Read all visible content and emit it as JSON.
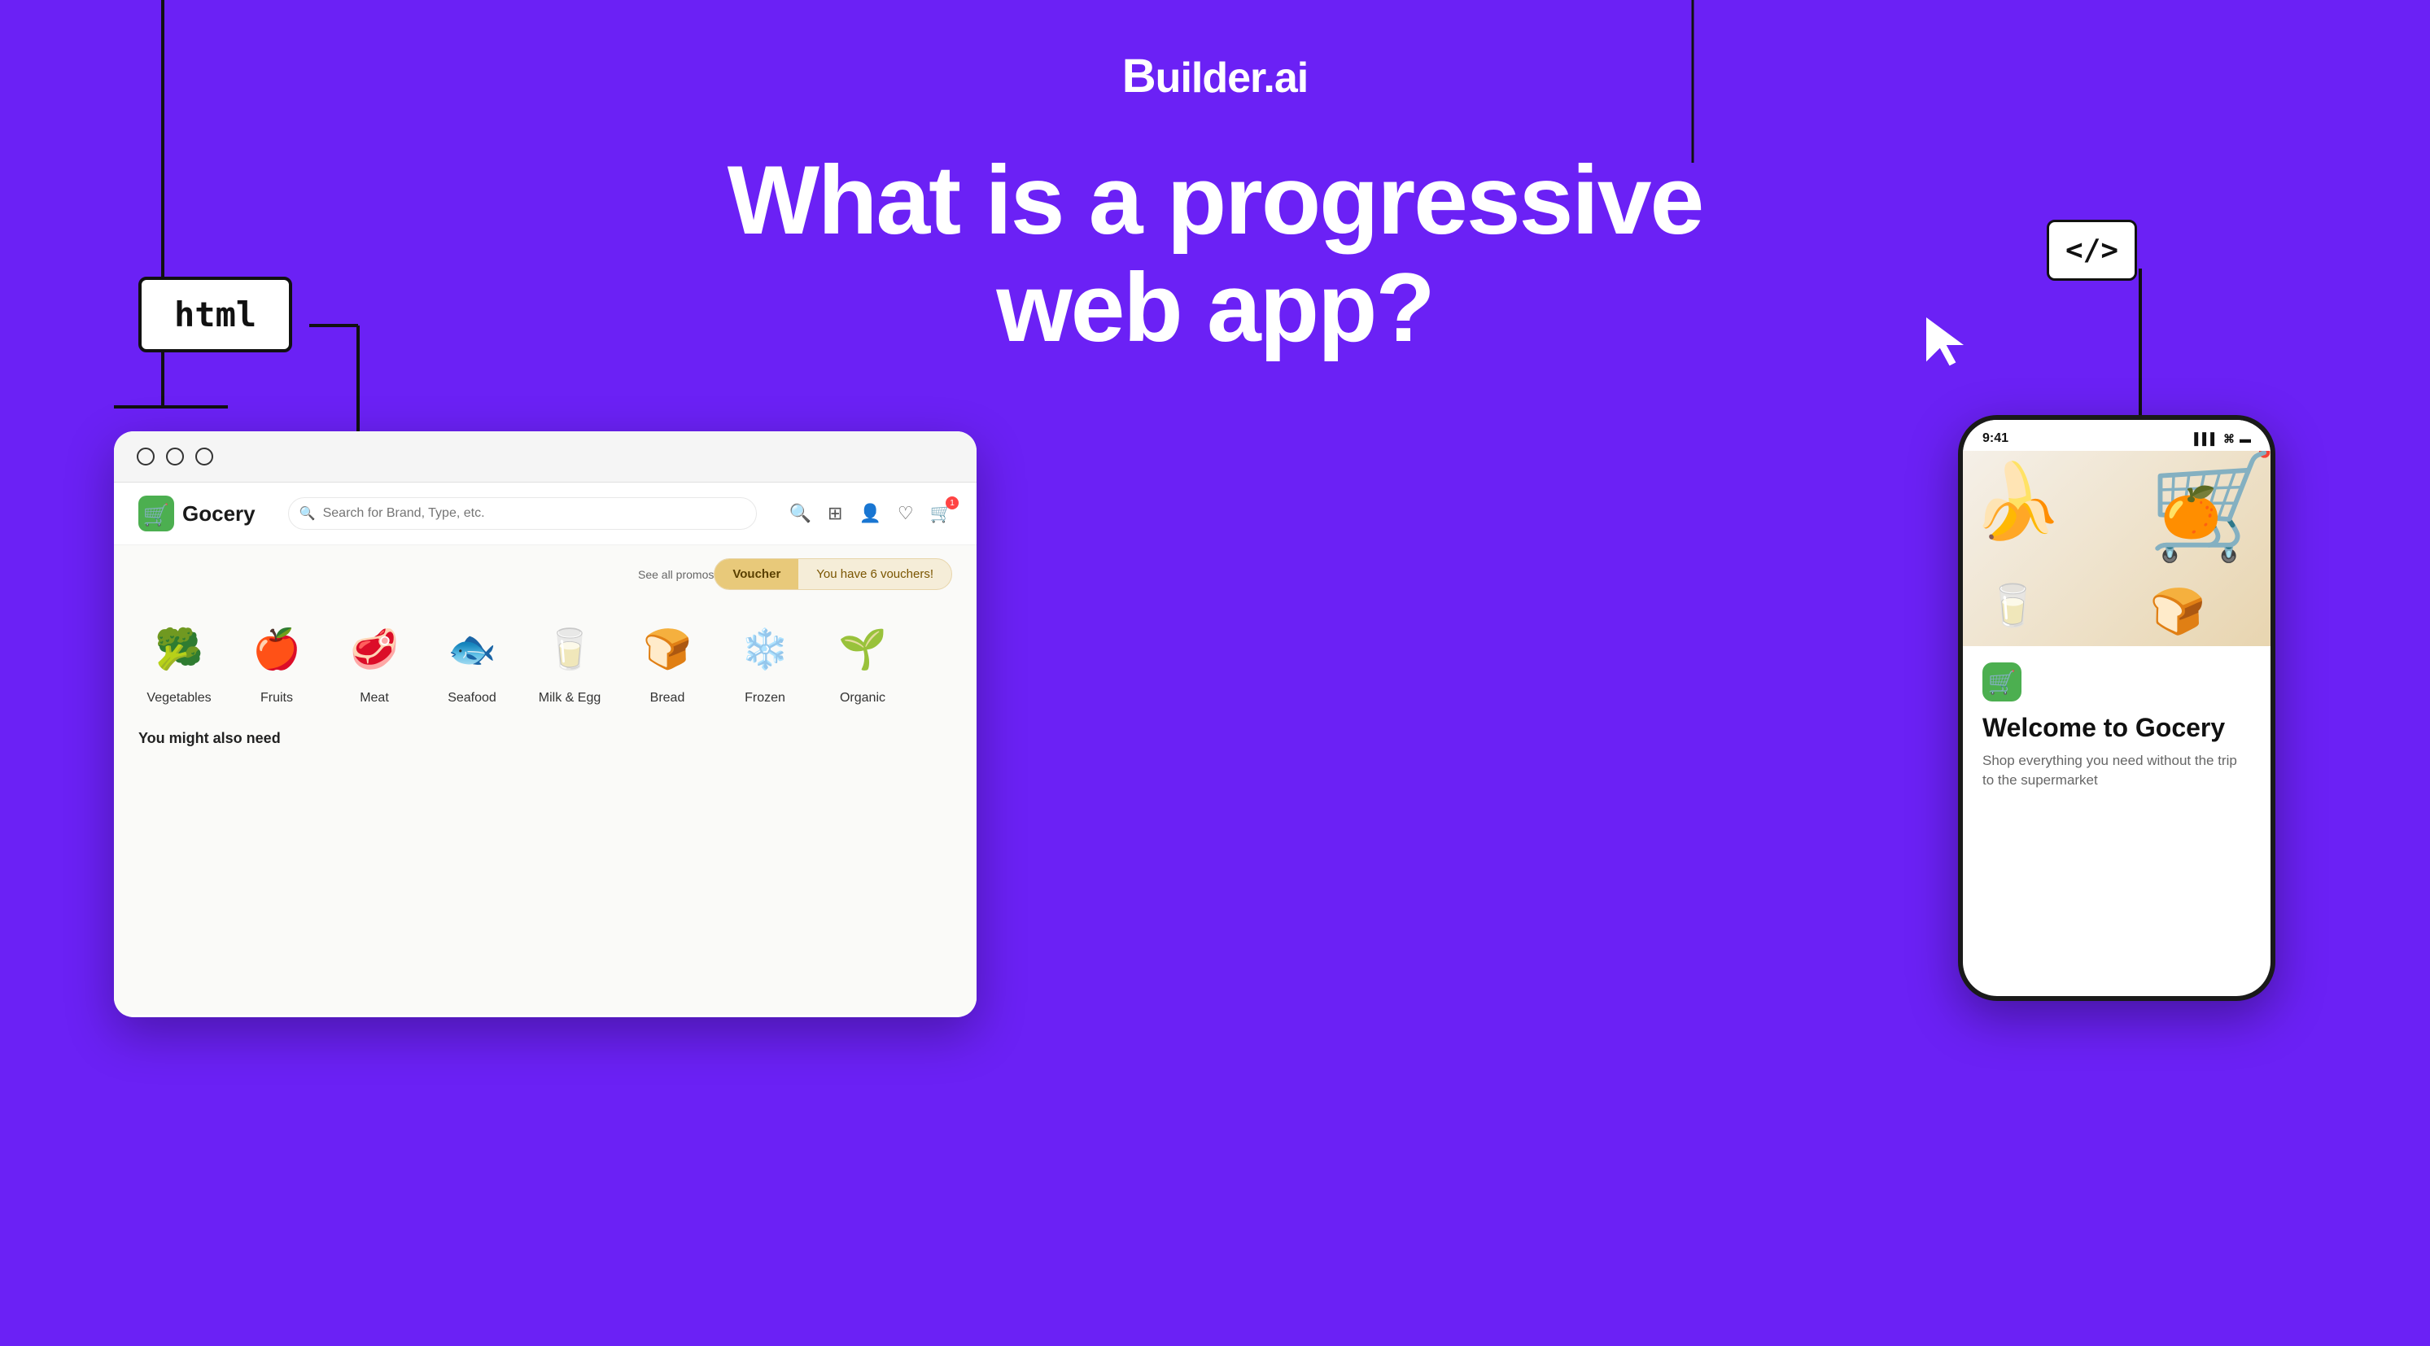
{
  "brand": {
    "name": "Builder.ai",
    "name_bold": "B",
    "name_rest": "uilder.ai"
  },
  "heading": {
    "line1": "What is a progressive",
    "line2": "web app?"
  },
  "html_tag": {
    "label": "html"
  },
  "code_tag": {
    "label": "</>"
  },
  "browser": {
    "voucher_label": "Voucher",
    "voucher_text": "You have 6 vouchers!",
    "see_all_promos": "See all promos",
    "you_might_need": "You might also need",
    "app_name": "Gocery",
    "search_placeholder": "Search for Brand, Type, etc.",
    "categories": [
      {
        "label": "Vegetables",
        "emoji": "🥦"
      },
      {
        "label": "Fruits",
        "emoji": "🍎"
      },
      {
        "label": "Meat",
        "emoji": "🥩"
      },
      {
        "label": "Seafood",
        "emoji": "🐟"
      },
      {
        "label": "Milk & Egg",
        "emoji": "🥛"
      },
      {
        "label": "Bread",
        "emoji": "🍞"
      },
      {
        "label": "Frozen",
        "emoji": "❄️"
      },
      {
        "label": "Organic",
        "emoji": "🌱"
      }
    ]
  },
  "mobile": {
    "time": "9:41",
    "welcome_title": "Welcome to Gocery",
    "welcome_subtitle": "Shop everything you need without the trip to the supermarket"
  },
  "colors": {
    "bg_purple": "#6B21F5",
    "white": "#ffffff"
  }
}
